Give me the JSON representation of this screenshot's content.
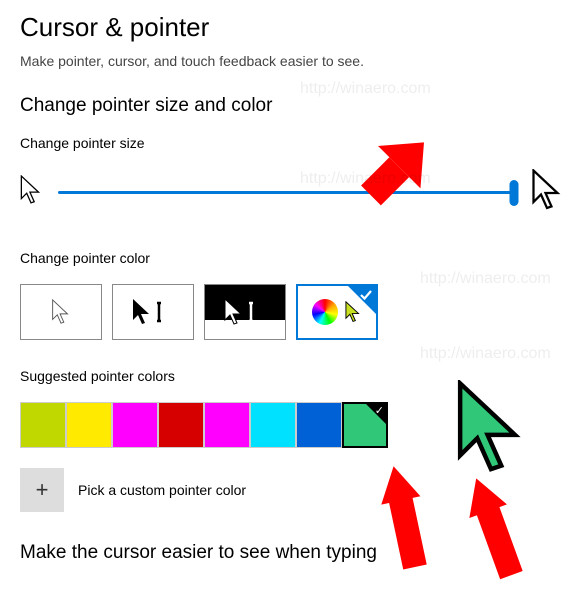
{
  "page": {
    "title": "Cursor & pointer",
    "subtitle": "Make pointer, cursor, and touch feedback easier to see."
  },
  "sizeSection": {
    "heading": "Change pointer size and color",
    "label": "Change pointer size",
    "sliderValuePercent": 100
  },
  "colorSection": {
    "label": "Change pointer color",
    "options": [
      {
        "id": "white",
        "name": "white-cursor"
      },
      {
        "id": "black",
        "name": "black-cursor"
      },
      {
        "id": "inverted",
        "name": "inverted-cursor"
      },
      {
        "id": "custom",
        "name": "custom-color-cursor",
        "selected": true
      }
    ]
  },
  "suggested": {
    "label": "Suggested pointer colors",
    "swatches": [
      {
        "hex": "#c0d800"
      },
      {
        "hex": "#ffea00"
      },
      {
        "hex": "#ff00ff"
      },
      {
        "hex": "#d60000"
      },
      {
        "hex": "#ff00ff"
      },
      {
        "hex": "#00e0ff"
      },
      {
        "hex": "#0060d6"
      },
      {
        "hex": "#30c878",
        "selected": true
      }
    ],
    "pickLabel": "Pick a custom pointer color"
  },
  "bottom": {
    "heading": "Make the cursor easier to see when typing"
  },
  "watermark": {
    "text": "http://winaero.com"
  },
  "annotations": {
    "arrowColor": "#ff0000",
    "bigCursorFill": "#30c878"
  }
}
